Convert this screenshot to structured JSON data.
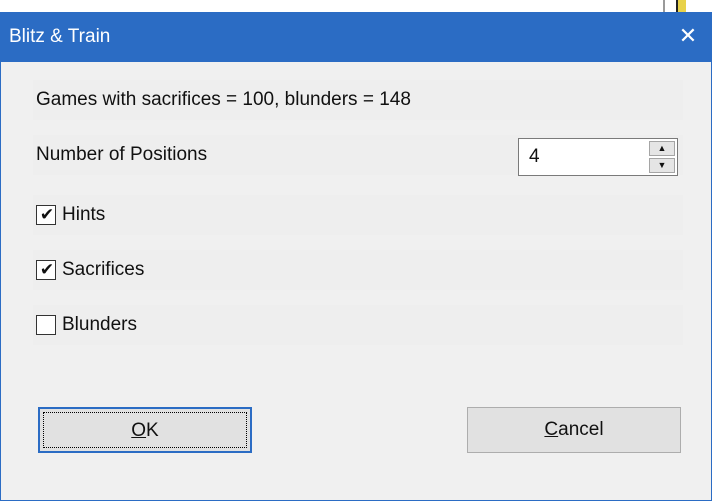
{
  "window": {
    "title": "Blitz & Train",
    "close_glyph": "✕"
  },
  "info": {
    "text": "Games with sacrifices = 100, blunders = 148"
  },
  "positions": {
    "label": "Number of Positions",
    "value": "4",
    "up_icon": "▲",
    "down_icon": "▼"
  },
  "options": {
    "hints": {
      "label": "Hints",
      "checked": true
    },
    "sacrifices": {
      "label": "Sacrifices",
      "checked": true
    },
    "blunders": {
      "label": "Blunders",
      "checked": false
    },
    "check_glyph": "✔"
  },
  "buttons": {
    "ok": {
      "mnemonic": "O",
      "rest": "K"
    },
    "cancel": {
      "mnemonic": "C",
      "rest": "ancel"
    }
  },
  "colors": {
    "titlebar": "#2b6cc4",
    "dialog_bg": "#f0f0f0"
  }
}
